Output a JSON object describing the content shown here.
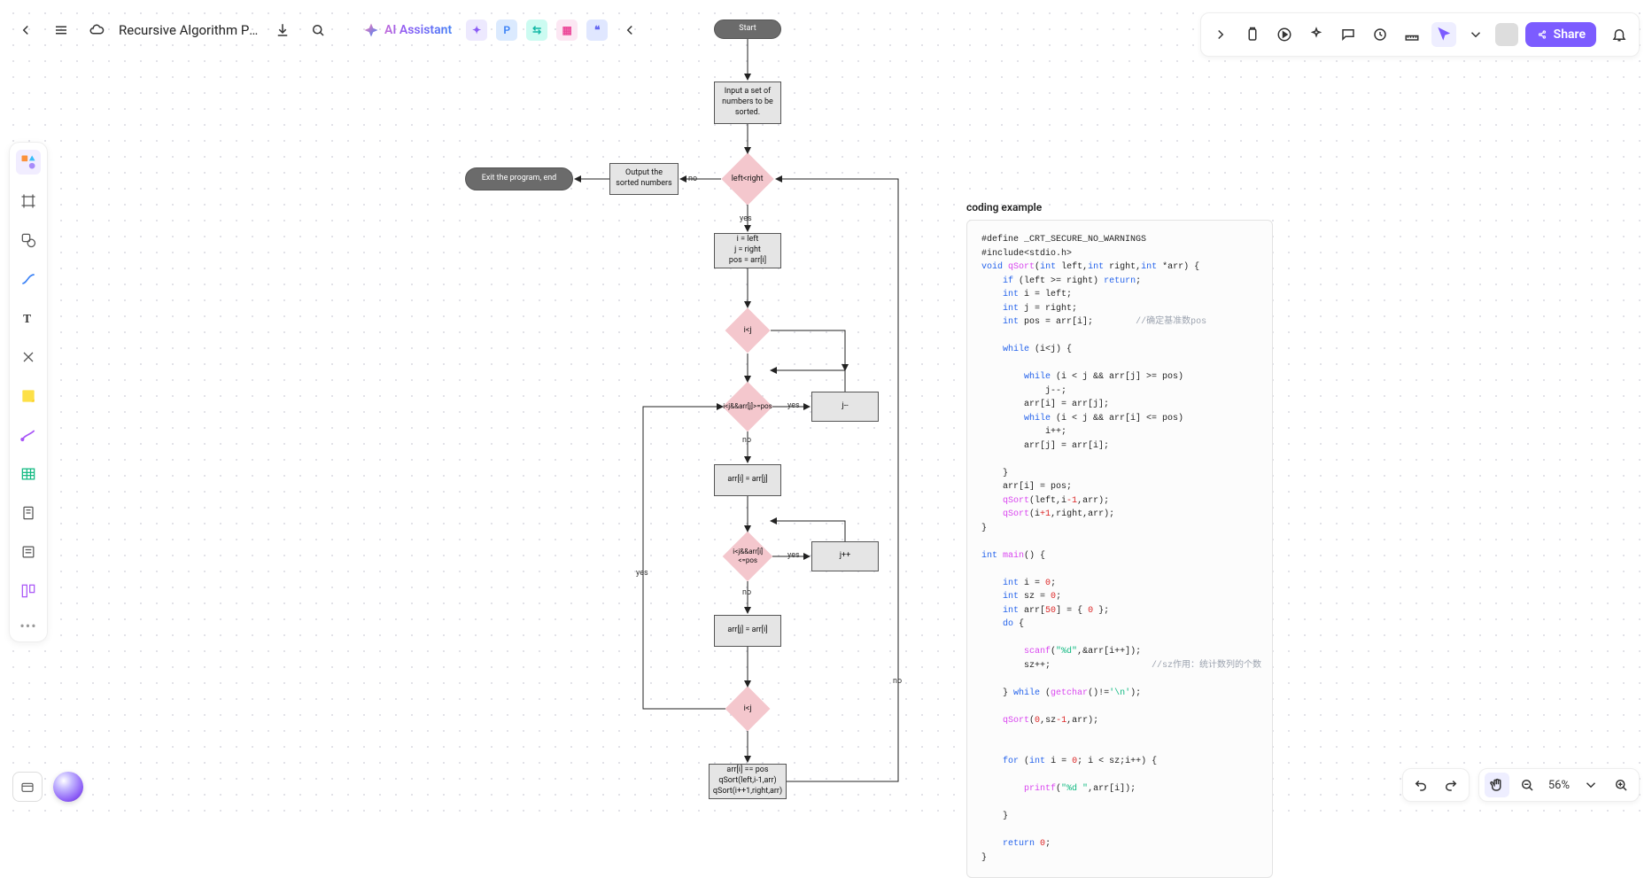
{
  "header": {
    "title": "Recursive Algorithm Pro...",
    "ai_label": "AI Assistant",
    "share_label": "Share"
  },
  "zoom": {
    "label": "56%"
  },
  "flow": {
    "start": "Start",
    "input": "Input a set of numbers to be sorted.",
    "cond_lr": "left<right",
    "output": "Output the sorted numbers",
    "exit": "Exit the program, end",
    "no": "no",
    "yes": "yes",
    "init1": "i = left",
    "init2": "j = right",
    "init3": "pos = arr[i]",
    "cond_ij": "i<j",
    "cond_jpos": "i<j&&arr[j]>=pos",
    "jdec": "j--",
    "assign1": "arr[i] = arr[j]",
    "cond_ipos": "i<j&&arr[i]<=pos",
    "jinc": "j++",
    "assign2": "arr[j] = arr[i]",
    "cond_ij2": "i<j",
    "final1": "arr[i] == pos",
    "final2": "qSort(left,i-1,arr)",
    "final3": "qSort(i++1,right,arr)"
  },
  "code": {
    "title": "coding example"
  }
}
